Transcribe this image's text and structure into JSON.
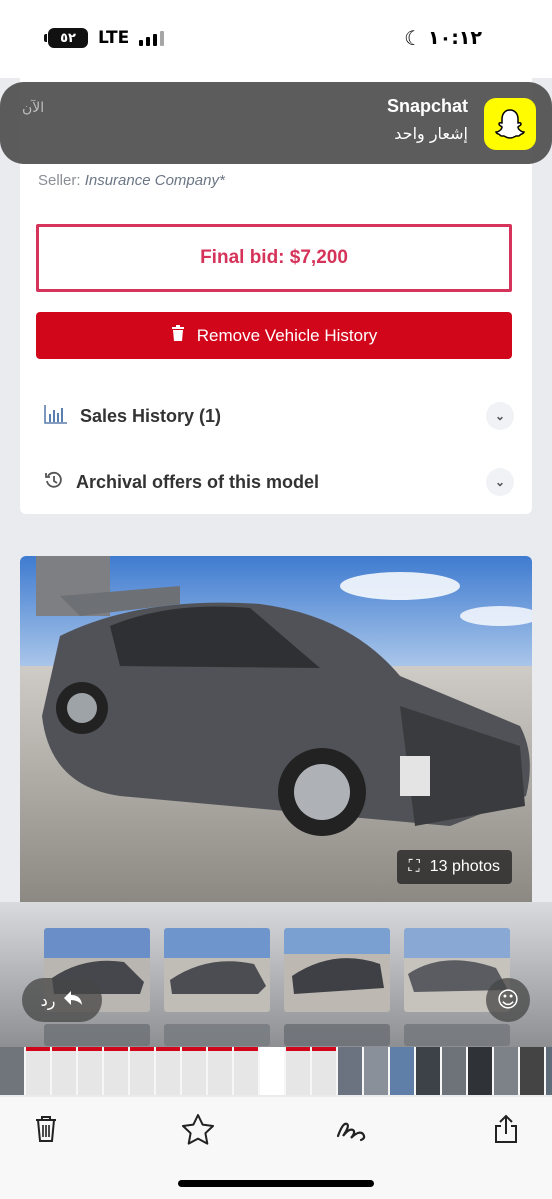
{
  "status_bar": {
    "battery": "٥٢",
    "network": "LTE",
    "time": "١٠:١٢"
  },
  "notification": {
    "app": "Snapchat",
    "message": "إشعار واحد",
    "time": "الآن"
  },
  "listing": {
    "seller_label": "Seller:",
    "seller_value": "Insurance Company*",
    "final_bid": "Final bid: $7,200",
    "remove_button": "Remove Vehicle History",
    "sales_history": "Sales History (1)",
    "archival_offers": "Archival offers of this model",
    "photo_count": "13 photos"
  },
  "reply": {
    "label": "رد"
  },
  "colors": {
    "accent_red": "#d2061a",
    "bid_red": "#d6335a",
    "snapchat_yellow": "#fffc00"
  },
  "toolbar": {
    "icons": [
      "trash-icon",
      "star-icon",
      "markup-icon",
      "share-icon"
    ]
  }
}
